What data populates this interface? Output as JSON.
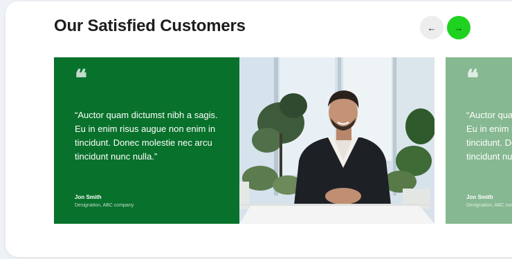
{
  "section": {
    "title": "Our Satisfied Customers"
  },
  "nav": {
    "prev_icon": "arrow-left-icon",
    "prev_glyph": "←",
    "next_icon": "arrow-right-icon",
    "next_glyph": "→"
  },
  "testimonials": [
    {
      "quote_glyph": "❛❛",
      "quote": "“Auctor quam dictumst nibh a sagis. Eu in enim risus augue non enim in tincidunt. Donec molestie nec arcu tincidunt nunc nulla.”",
      "author": "Jon Smith",
      "role": "Designation, ABC company"
    },
    {
      "quote_glyph": "❛❛",
      "quote": "“Auctor quam dictumst nibh a sagis. Eu in enim risus augue non enim in tincidunt. Donec molestie nec arcu tincidunt nunc nulla.”",
      "author": "Jon Smith",
      "role": "Designation, ABC company"
    }
  ],
  "colors": {
    "primary_green": "#08712b",
    "faded_green": "#86b891",
    "accent_green": "#1fd21f"
  }
}
